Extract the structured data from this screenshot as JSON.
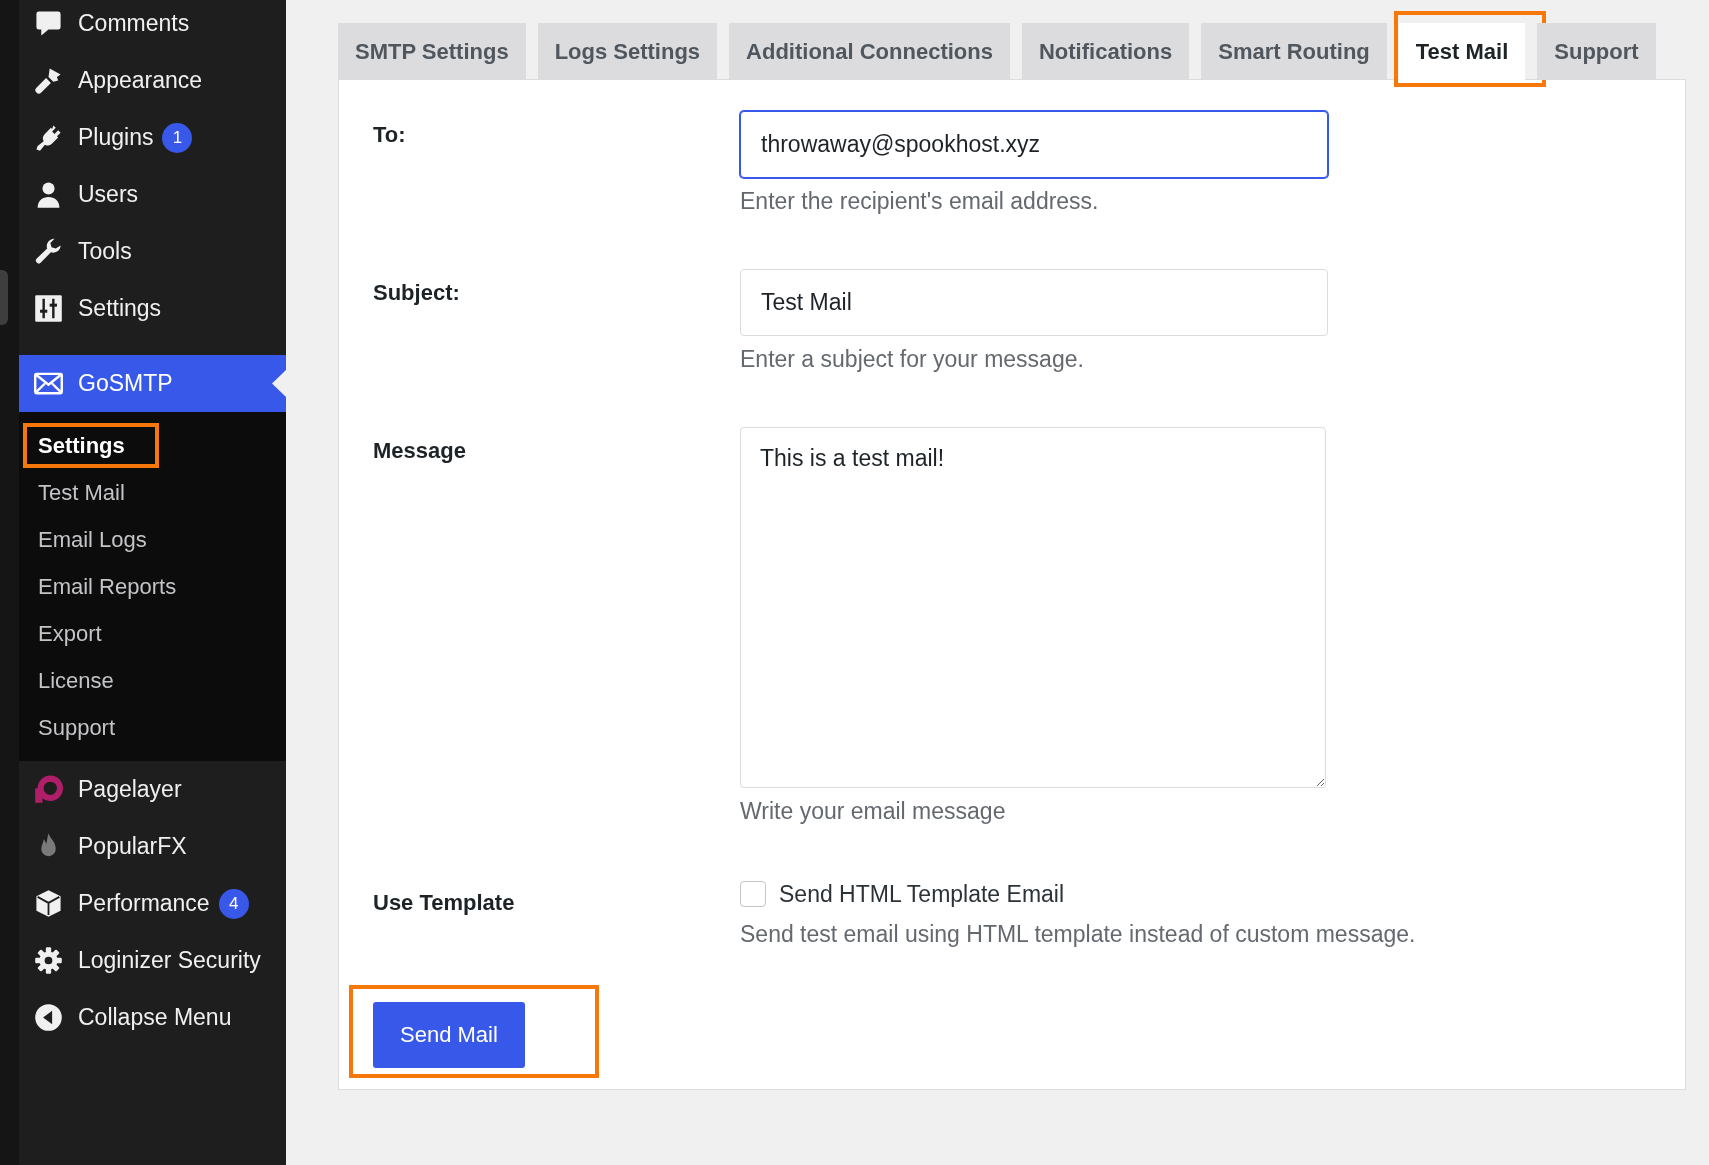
{
  "sidebar": {
    "menu": [
      {
        "label": "Comments",
        "selected": false
      },
      {
        "label": "Appearance",
        "selected": false
      },
      {
        "label": "Plugins",
        "badge": "1",
        "selected": false
      },
      {
        "label": "Users",
        "selected": false
      },
      {
        "label": "Tools",
        "selected": false
      },
      {
        "label": "Settings",
        "selected": false
      },
      {
        "label": "GoSMTP",
        "selected": true,
        "submenu": [
          {
            "label": "Settings",
            "selected": true,
            "highlighted": true
          },
          {
            "label": "Test Mail",
            "selected": false,
            "highlighted": false
          },
          {
            "label": "Email Logs",
            "selected": false,
            "highlighted": false
          },
          {
            "label": "Email Reports",
            "selected": false,
            "highlighted": false
          },
          {
            "label": "Export",
            "selected": false,
            "highlighted": false
          },
          {
            "label": "License",
            "selected": false,
            "highlighted": false
          },
          {
            "label": "Support",
            "selected": false,
            "highlighted": false
          }
        ]
      },
      {
        "label": "Pagelayer",
        "selected": false
      },
      {
        "label": "PopularFX",
        "selected": false
      },
      {
        "label": "Performance",
        "badge": "4",
        "selected": false
      },
      {
        "label": "Loginizer Security",
        "selected": false
      },
      {
        "label": "Collapse Menu",
        "selected": false
      }
    ]
  },
  "tabs": [
    {
      "label": "SMTP Settings",
      "selected": false,
      "highlighted": false
    },
    {
      "label": "Logs Settings",
      "selected": false,
      "highlighted": false
    },
    {
      "label": "Additional Connections",
      "selected": false,
      "highlighted": false
    },
    {
      "label": "Notifications",
      "selected": false,
      "highlighted": false
    },
    {
      "label": "Smart Routing",
      "selected": false,
      "highlighted": false
    },
    {
      "label": "Test Mail",
      "selected": true,
      "highlighted": true
    },
    {
      "label": "Support",
      "selected": false,
      "highlighted": false
    }
  ],
  "form": {
    "fields": [
      {
        "kind": "input",
        "label": "To:",
        "value": "throwaway@spookhost.xyz",
        "focused": true,
        "help": "Enter the recipient's email address."
      },
      {
        "kind": "input",
        "label": "Subject:",
        "value": "Test Mail",
        "focused": false,
        "help": "Enter a subject for your message."
      },
      {
        "kind": "textarea",
        "label": "Message",
        "value": "This is a test mail!",
        "help": "Write your email message"
      },
      {
        "kind": "checkbox",
        "label": "Use Template",
        "option": "Send HTML Template Email",
        "checked": false,
        "help": "Send test email using HTML template instead of custom message."
      }
    ],
    "submit": {
      "label": "Send Mail",
      "highlighted": true
    }
  }
}
